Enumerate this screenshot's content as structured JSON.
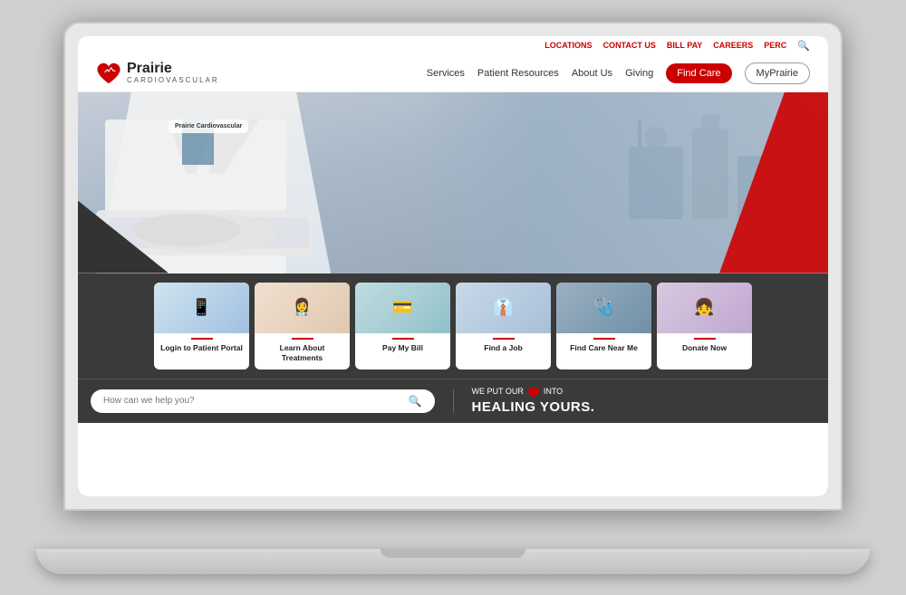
{
  "laptop": {
    "screen": {
      "topnav": {
        "links": [
          "LOCATIONS",
          "CONTACT US",
          "BILL PAY",
          "CAREERS",
          "PERC"
        ],
        "logo_main": "Prairie",
        "logo_sub": "CARDIOVASCULAR",
        "nav_items": [
          "Services",
          "Patient Resources",
          "About Us",
          "Giving"
        ],
        "btn_find_care": "Find Care",
        "btn_myp": "MyPrairie"
      },
      "search": {
        "placeholder": "How can we help you?"
      },
      "tagline": {
        "top": "WE PUT OUR",
        "bottom": "HEALING YOURS."
      },
      "action_cards": [
        {
          "label": "Login to Patient Portal",
          "icon": "📱"
        },
        {
          "label": "Learn About Treatments",
          "icon": "👩‍⚕️"
        },
        {
          "label": "Pay My Bill",
          "icon": "💳"
        },
        {
          "label": "Find a Job",
          "icon": "👔"
        },
        {
          "label": "Find Care Near Me",
          "icon": "🩺"
        },
        {
          "label": "Donate Now",
          "icon": "👧"
        }
      ],
      "branding_badge": "Prairie Cardiovascular"
    }
  }
}
